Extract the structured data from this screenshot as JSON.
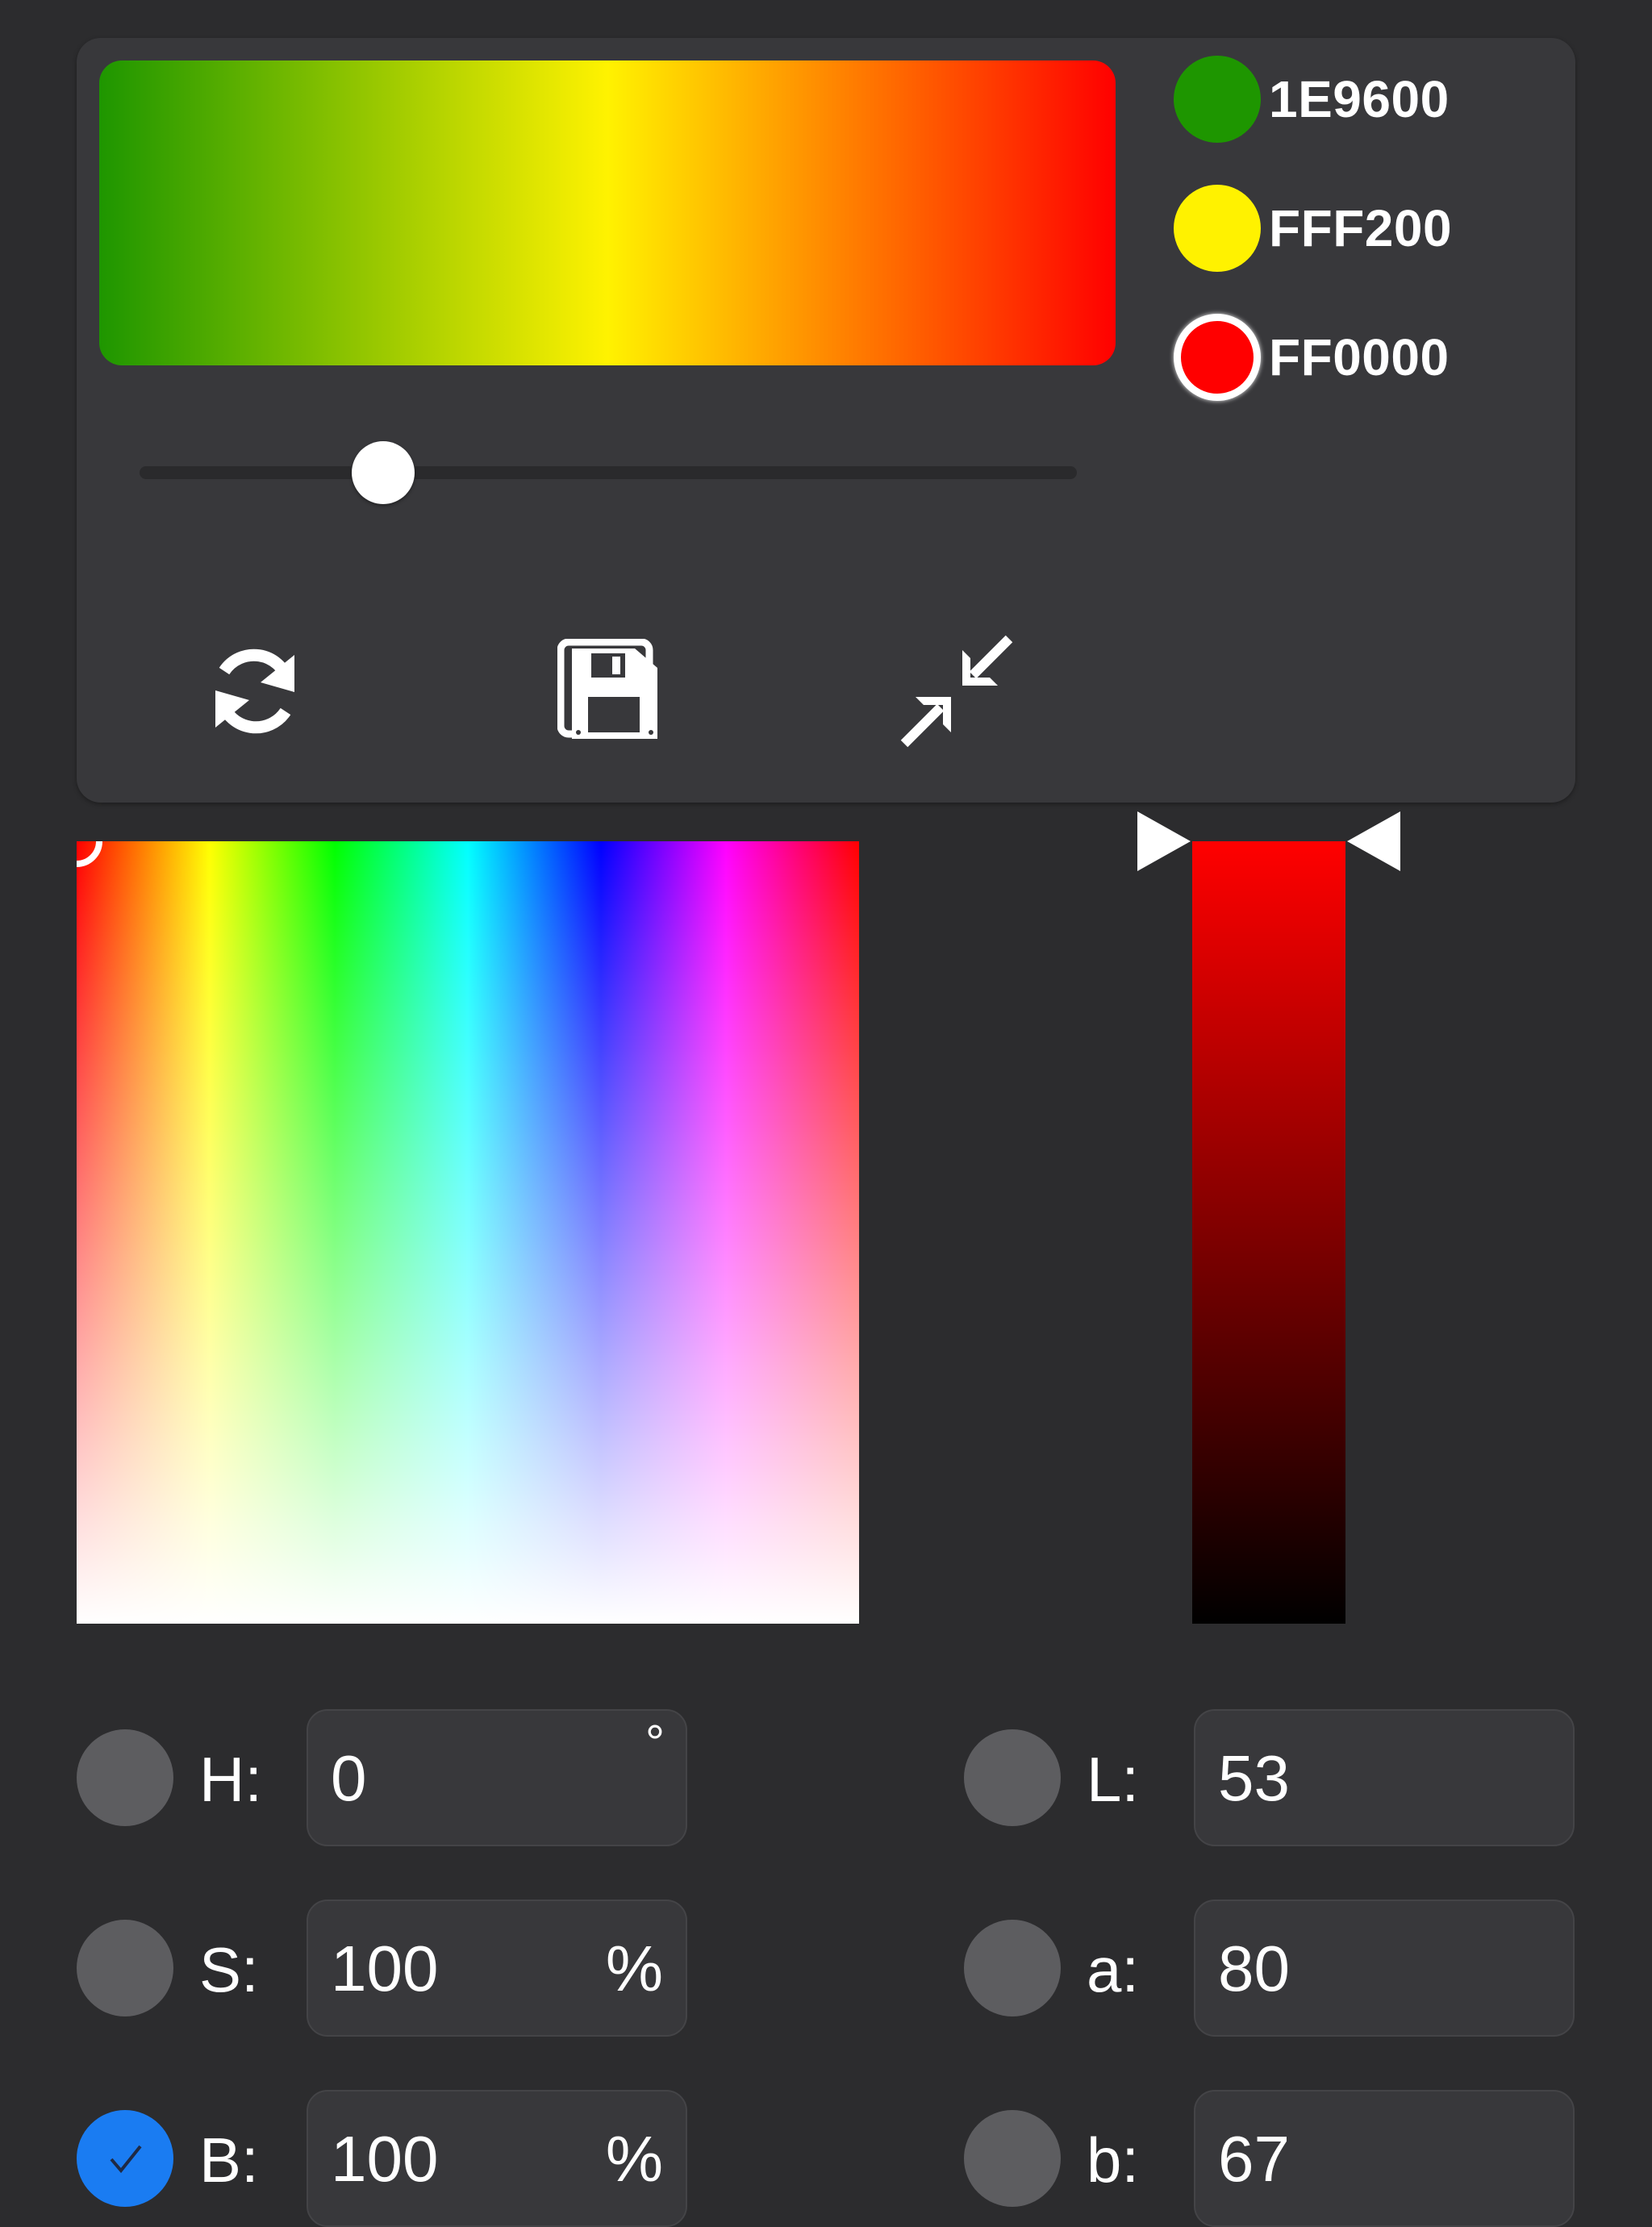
{
  "gradient_editor": {
    "stops": [
      {
        "hex_label": "1E9600",
        "color": "#1e9600",
        "selected": false
      },
      {
        "hex_label": "FFF200",
        "color": "#fff200",
        "selected": false
      },
      {
        "hex_label": "FF0000",
        "color": "#ff0000",
        "selected": true
      }
    ],
    "slider_position": 0.26,
    "toolbar": {
      "refresh_icon": "refresh-icon",
      "save_icon": "save-floppy-icon",
      "collapse_icon": "collapse-arrows-icon"
    }
  },
  "picker": {
    "hue_cursor": {
      "x_fraction": 0.0,
      "y_fraction": 0.0
    },
    "brightness_marker_fraction": 0.0,
    "selected_color": "#ff0000"
  },
  "channels": {
    "h": {
      "label": "H:",
      "value": "0",
      "unit": "°",
      "checked": false
    },
    "s": {
      "label": "S:",
      "value": "100",
      "unit": "%",
      "checked": false
    },
    "b": {
      "label": "B:",
      "value": "100",
      "unit": "%",
      "checked": true
    },
    "l": {
      "label": "L:",
      "value": "53",
      "unit": "",
      "checked": false
    },
    "a": {
      "label": "a:",
      "value": "80",
      "unit": "",
      "checked": false
    },
    "lab_b": {
      "label": "b:",
      "value": "67",
      "unit": "",
      "checked": false
    }
  },
  "colors": {
    "background": "#2c2c2e",
    "panel": "#38383b",
    "radio_off": "#5d5d60",
    "radio_on": "#1a7cf2"
  }
}
